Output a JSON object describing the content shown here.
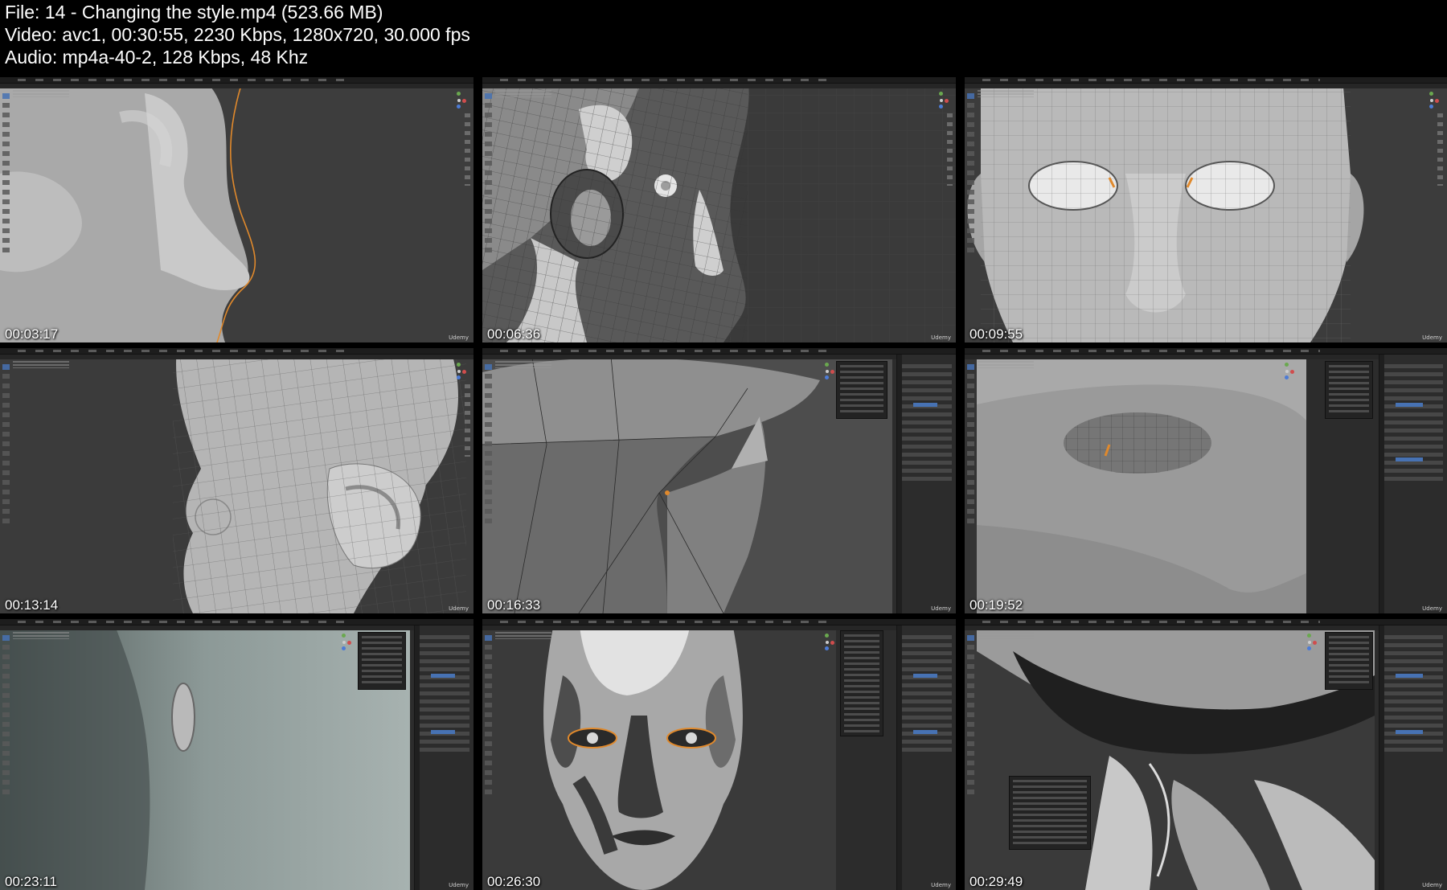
{
  "header": {
    "file_line": "File: 14 - Changing the style.mp4 (523.66 MB)",
    "video_line": "Video: avc1, 00:30:55, 2230 Kbps, 1280x720, 30.000 fps",
    "audio_line": "Audio: mp4a-40-2, 128 Kbps, 48 Khz"
  },
  "brand_label": "Udemy",
  "thumbnails": [
    {
      "timestamp": "00:03:17",
      "subject": "side-profile-nose-icon"
    },
    {
      "timestamp": "00:06:36",
      "subject": "ear-wireframe-icon"
    },
    {
      "timestamp": "00:09:55",
      "subject": "front-face-mesh-icon"
    },
    {
      "timestamp": "00:13:14",
      "subject": "head-ear-wireframe-icon"
    },
    {
      "timestamp": "00:16:33",
      "subject": "closeup-mesh-icon"
    },
    {
      "timestamp": "00:19:52",
      "subject": "eye-socket-icon"
    },
    {
      "timestamp": "00:23:11",
      "subject": "ear-side-view-icon"
    },
    {
      "timestamp": "00:26:30",
      "subject": "toon-shaded-face-icon"
    },
    {
      "timestamp": "00:29:49",
      "subject": "jaw-toon-icon"
    }
  ],
  "colors": {
    "background": "#000000",
    "viewport": "#3a3a3a",
    "blender_blue": "#4772b3",
    "selection_orange": "#e0892c"
  }
}
